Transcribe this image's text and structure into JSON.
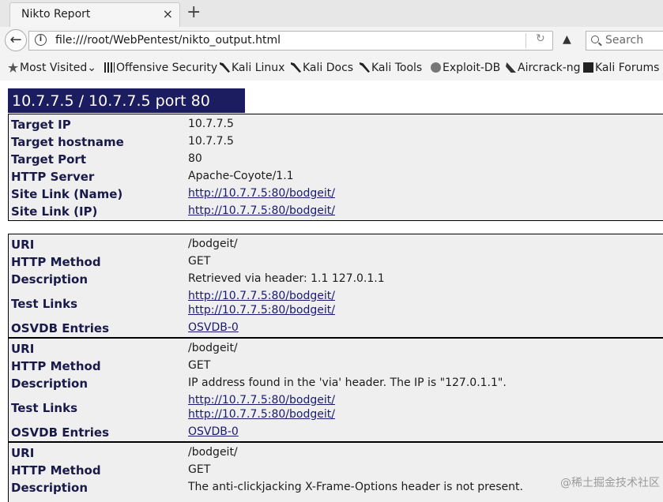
{
  "browser": {
    "tab_title": "Nikto Report",
    "tab_close": "×",
    "new_tab": "+",
    "url": "file:///root/WebPentest/nikto_output.html",
    "search_placeholder": "Search",
    "bookmarks": [
      "Most Visited",
      "Offensive Security",
      "Kali Linux",
      "Kali Docs",
      "Kali Tools",
      "Exploit-DB",
      "Aircrack-ng",
      "Kali Forums"
    ]
  },
  "report": {
    "header": "10.7.7.5 / 10.7.7.5 port 80",
    "host_info": [
      {
        "label": "Target IP",
        "value": "10.7.7.5"
      },
      {
        "label": "Target hostname",
        "value": "10.7.7.5"
      },
      {
        "label": "Target Port",
        "value": "80"
      },
      {
        "label": "HTTP Server",
        "value": "Apache-Coyote/1.1"
      },
      {
        "label": "Site Link (Name)",
        "value": "http://10.7.7.5:80/bodgeit/"
      },
      {
        "label": "Site Link (IP)",
        "value": "http://10.7.7.5:80/bodgeit/"
      }
    ],
    "labels": {
      "uri": "URI",
      "method": "HTTP Method",
      "description": "Description",
      "test_links": "Test Links",
      "osvdb": "OSVDB Entries"
    },
    "findings": [
      {
        "uri": "/bodgeit/",
        "method": "GET",
        "description": "Retrieved via header: 1.1 127.0.1.1",
        "test_links": [
          "http://10.7.7.5:80/bodgeit/",
          "http://10.7.7.5:80/bodgeit/"
        ],
        "osvdb": "OSVDB-0"
      },
      {
        "uri": "/bodgeit/",
        "method": "GET",
        "description": "IP address found in the 'via' header. The IP is \"127.0.1.1\".",
        "test_links": [
          "http://10.7.7.5:80/bodgeit/",
          "http://10.7.7.5:80/bodgeit/"
        ],
        "osvdb": "OSVDB-0"
      },
      {
        "uri": "/bodgeit/",
        "method": "GET",
        "description": "The anti-clickjacking X-Frame-Options header is not present."
      }
    ]
  },
  "watermark": "@稀土掘金技术社区"
}
